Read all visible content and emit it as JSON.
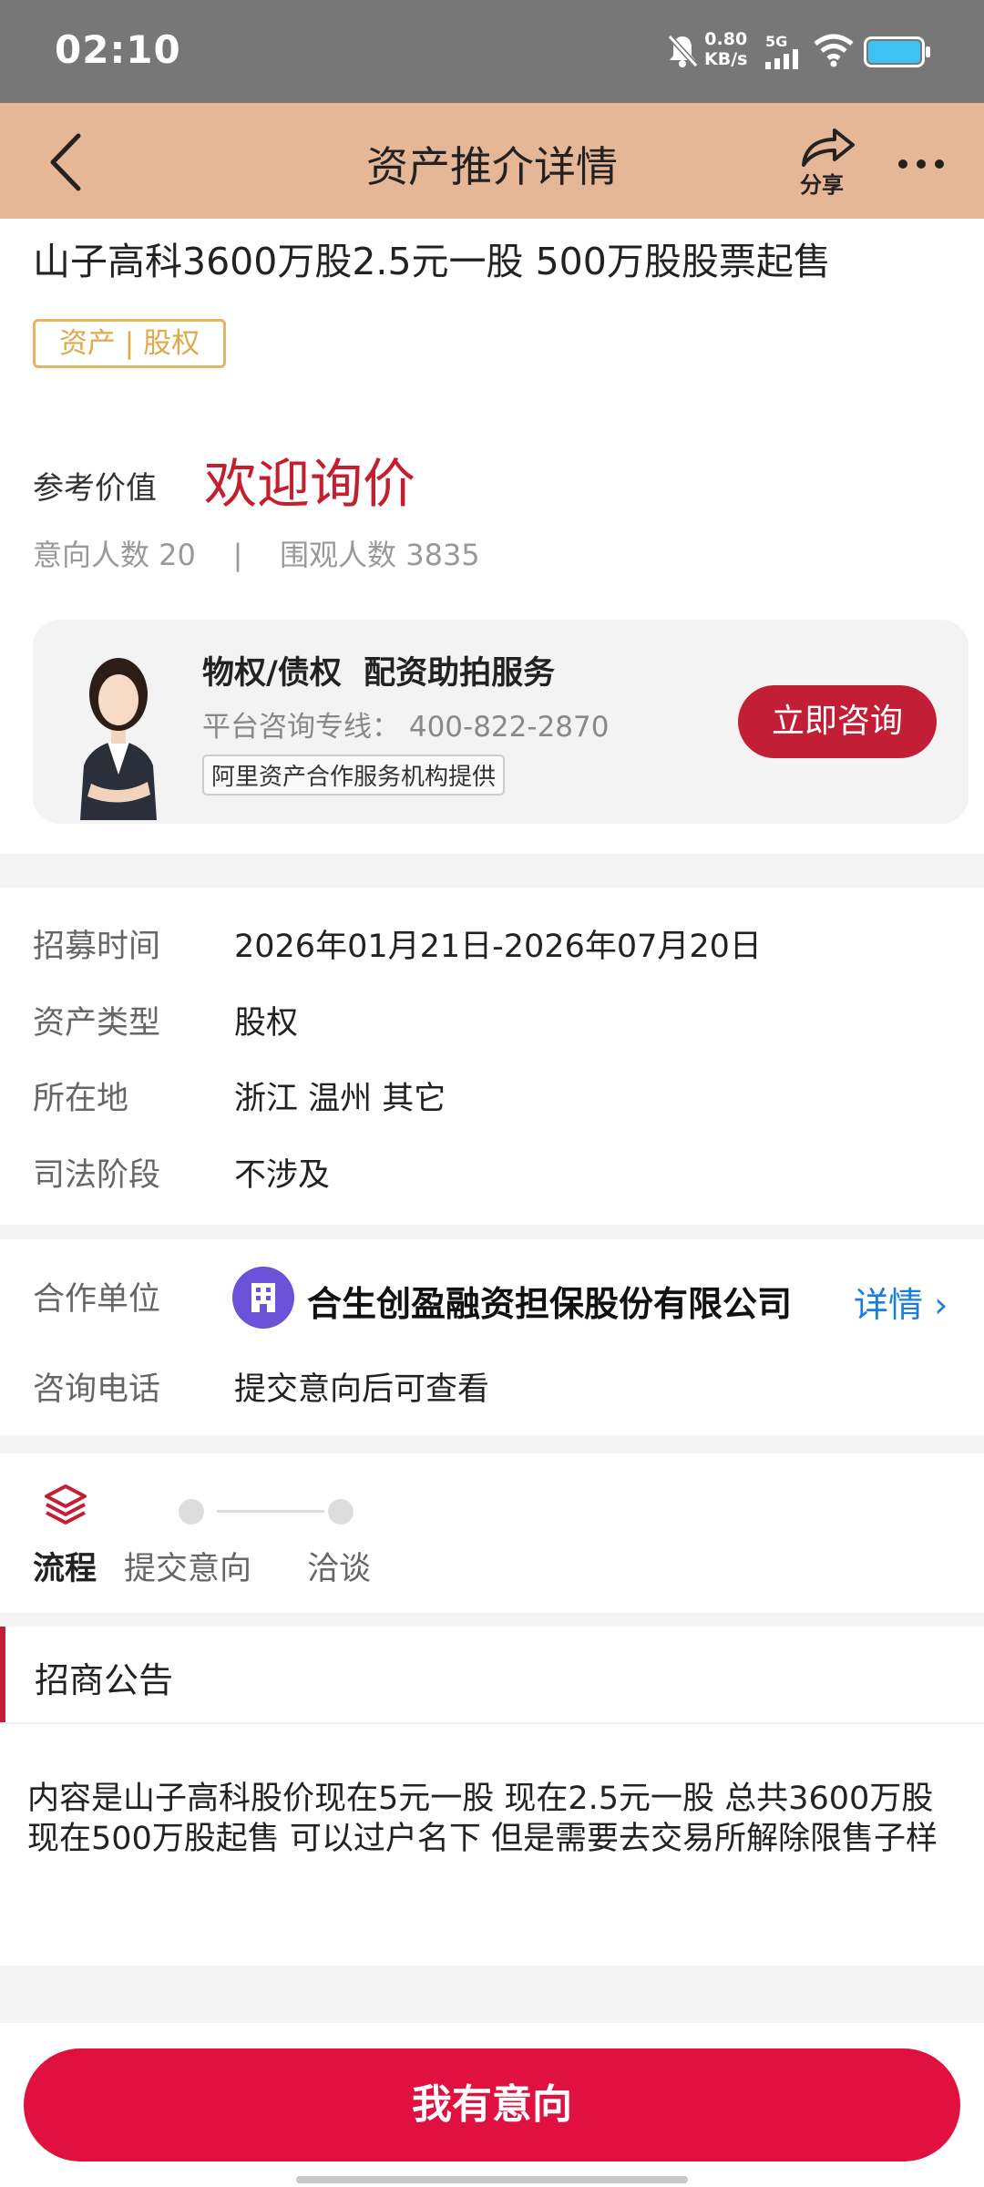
{
  "status_bar": {
    "time": "02:10",
    "speed_value": "0.80",
    "speed_unit": "KB/s",
    "network": "5G",
    "icons": [
      "mute-bell-icon",
      "signal-icon",
      "wifi-icon",
      "battery-icon"
    ]
  },
  "header": {
    "title": "资产推介详情",
    "share_label": "分享",
    "icons": [
      "back-arrow-icon",
      "share-arrow-icon",
      "more-dots-icon"
    ]
  },
  "asset": {
    "title": "山子高科3600万股2.5元一股 500万股股票起售",
    "tag": "资产 | 股权",
    "ref_label": "参考价值",
    "ref_value": "欢迎询价",
    "stats": "意向人数 20    |    围观人数 3835"
  },
  "service": {
    "title": "物权/债权  配资助拍服务",
    "hotline": "平台咨询专线： 400-822-2870",
    "provider": "阿里资产合作服务机构提供",
    "consult_button": "立即咨询"
  },
  "info": {
    "rows": [
      {
        "label": "招募时间",
        "value": "2026年01月21日-2026年07月20日"
      },
      {
        "label": "资产类型",
        "value": "股权"
      },
      {
        "label": "所在地",
        "value": "浙江 温州 其它"
      },
      {
        "label": "司法阶段",
        "value": "不涉及"
      }
    ]
  },
  "partner": {
    "label": "合作单位",
    "company": "合生创盈融资担保股份有限公司",
    "detail_link": "详情 ›",
    "phone_label": "咨询电话",
    "phone_value": "提交意向后可查看"
  },
  "process": {
    "title": "流程",
    "steps": [
      "提交意向",
      "洽谈"
    ]
  },
  "announcement": {
    "title": "招商公告",
    "body": "内容是山子高科股价现在5元一股 现在2.5元一股   总共3600万股 现在500万股起售  可以过户名下 但是需要去交易所解除限售子样"
  },
  "bottom": {
    "button": "我有意向"
  },
  "colors": {
    "header_bg": "#e6b796",
    "accent_red": "#c41f2f",
    "button_red": "#e0113e",
    "tag_gold": "#e0a848",
    "link_blue": "#1a7ee0"
  }
}
